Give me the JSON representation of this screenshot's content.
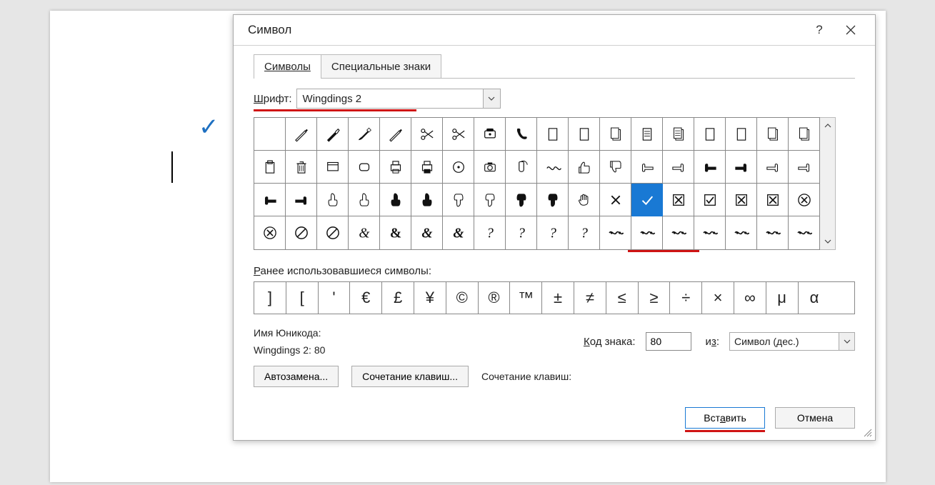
{
  "dialog": {
    "title": "Символ",
    "help_tooltip": "?",
    "tabs": {
      "symbols": "Символы",
      "special": "Специальные знаки",
      "active": "symbols"
    },
    "font_label": "Шрифт:",
    "font_value": "Wingdings 2",
    "recent_label": "Ранее использовавшиеся символы:",
    "unicode_name_label": "Имя Юникода:",
    "unicode_name_value": "Wingdings 2: 80",
    "code_label": "Код знака:",
    "code_value": "80",
    "from_label": "из:",
    "from_value": "Символ (дес.)",
    "autocorrect_btn": "Автозамена...",
    "shortcut_btn": "Сочетание клавиш...",
    "shortcut_label": "Сочетание клавиш:",
    "insert_btn": "Вставить",
    "cancel_btn": "Отмена"
  },
  "grid": {
    "selected": {
      "row": 2,
      "col": 12
    },
    "cells": [
      [
        "blank",
        "pen",
        "fountain-pen",
        "brush",
        "pencil",
        "scissors-1",
        "scissors-2",
        "phone",
        "handset",
        "page",
        "page-blank",
        "pages-copy",
        "page-lines",
        "pages-lines",
        "page-alt",
        "page-alt2",
        "pages-stack",
        "pages-stack2"
      ],
      [
        "clipboard",
        "trash",
        "window",
        "rounded-rect",
        "printer",
        "printer-alt",
        "disc",
        "camera",
        "mouse",
        "wave",
        "thumb-up",
        "thumb-down",
        "hand-left-open",
        "hand-right-open",
        "hand-left-solid",
        "hand-right-solid",
        "hand-point-open",
        "hand-point-right"
      ],
      [
        "hand-left-solid2",
        "hand-right-solid2",
        "finger-up-open",
        "finger-up-open2",
        "finger-up-solid",
        "finger-up-solid2",
        "finger-down-open",
        "finger-down-open2",
        "finger-down-solid",
        "finger-down-solid2",
        "hand-spread",
        "x-mark",
        "check",
        "box-x",
        "box-check",
        "box-x2",
        "box-x3",
        "circle-x"
      ],
      [
        "circle-x2",
        "prohibit",
        "prohibit2",
        "ampersand-script",
        "ampersand-bold",
        "ampersand-alt",
        "ampersand-alt2",
        "question-script",
        "question-script2",
        "question-script3",
        "question-script4",
        "flourish-1",
        "flourish-2",
        "flourish-3",
        "flourish-4",
        "flourish-5",
        "flourish-6",
        "flourish-7"
      ]
    ]
  },
  "recent": [
    "]",
    "[",
    "'",
    "€",
    "£",
    "¥",
    "©",
    "®",
    "™",
    "±",
    "≠",
    "≤",
    "≥",
    "÷",
    "×",
    "∞",
    "μ",
    "α"
  ],
  "doc": {
    "check_glyph": "✓"
  }
}
